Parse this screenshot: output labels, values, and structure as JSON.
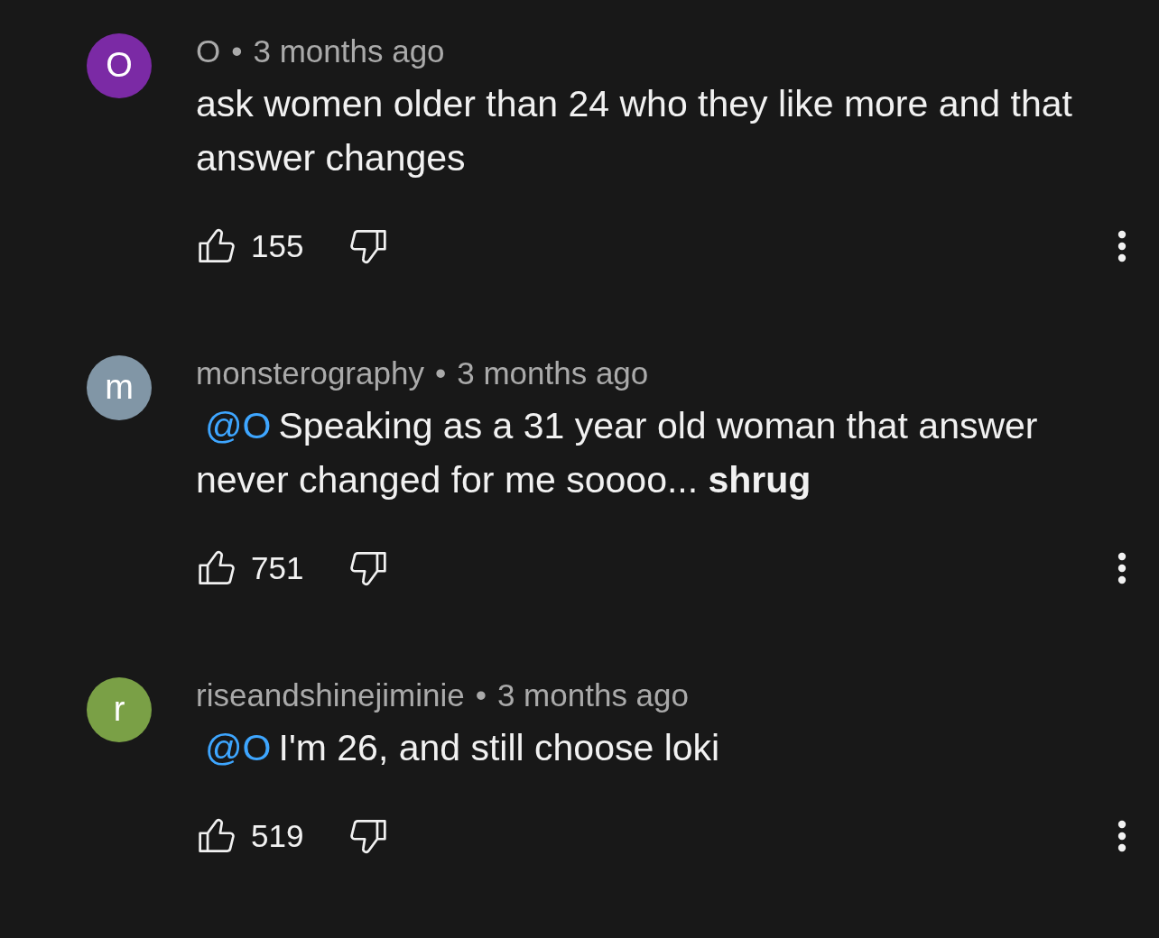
{
  "comments": [
    {
      "avatar": {
        "letter": "O",
        "color": "#7b2aa5"
      },
      "author": "O",
      "separator": "•",
      "time": "3 months ago",
      "text": "ask women older than 24 who they like more and that answer changes",
      "likes": "155"
    },
    {
      "avatar": {
        "letter": "m",
        "color": "#8196a6"
      },
      "author": "monsterography",
      "separator": "•",
      "time": "3 months ago",
      "mention": "@O",
      "text": "Speaking as a 31 year old woman that answer never changed for me soooo... **shrug**",
      "likes": "751"
    },
    {
      "avatar": {
        "letter": "r",
        "color": "#7aa046"
      },
      "author": "riseandshinejiminie",
      "separator": "•",
      "time": "3 months ago",
      "mention": "@O",
      "text": "I'm 26, and still choose loki",
      "likes": "519"
    }
  ]
}
